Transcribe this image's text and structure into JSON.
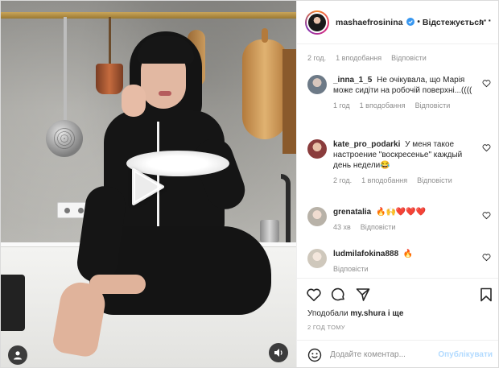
{
  "post": {
    "author": "mashaefrosinina",
    "follow_separator": "•",
    "follow_label": "Відстежується",
    "more_label": "···"
  },
  "comments": {
    "top_meta": {
      "time": "2 год.",
      "likes": "1 вподобання",
      "reply": "Відповісти"
    },
    "items": [
      {
        "user": "_inna_1_5",
        "text": "Не очікувала, що Марія може сидіти на робочій поверхні...((((",
        "time": "1 год",
        "likes": "1 вподобання",
        "reply": "Відповісти",
        "avatar_color": "#9aa6b2"
      },
      {
        "user": "kate_pro_podarki",
        "text": "У меня такое настроение \"воскресенье\" каждый день недели😂",
        "time": "2 год.",
        "likes": "1 вподобання",
        "reply": "Відповісти",
        "avatar_color": "#b06b6b"
      },
      {
        "user": "grenatalia",
        "text": "🔥🙌❤️❤️❤️",
        "time": "43 хв",
        "likes": "",
        "reply": "Відповісти",
        "avatar_color": "#c7c1b6"
      },
      {
        "user": "ludmilafokina888",
        "text": "🔥",
        "time": "",
        "likes": "",
        "reply": "Відповісти",
        "avatar_color": "#d9d4cc"
      }
    ]
  },
  "actions": {
    "liked_by_prefix": "Уподобали",
    "liked_by_user": "my.shura",
    "liked_by_suffix": "і ще",
    "time_ago": "2 ГОД ТОМУ"
  },
  "composer": {
    "placeholder": "Додайте коментар...",
    "post_label": "Опублікувати"
  },
  "colors": {
    "link_disabled": "#b3dbff",
    "secondary_text": "#8e8e8e",
    "verified": "#3897f0"
  },
  "icons": [
    "verified-badge-icon",
    "heart-icon",
    "comment-icon",
    "share-icon",
    "bookmark-icon",
    "emoji-icon",
    "play-icon",
    "user-tag-icon",
    "sound-icon"
  ]
}
